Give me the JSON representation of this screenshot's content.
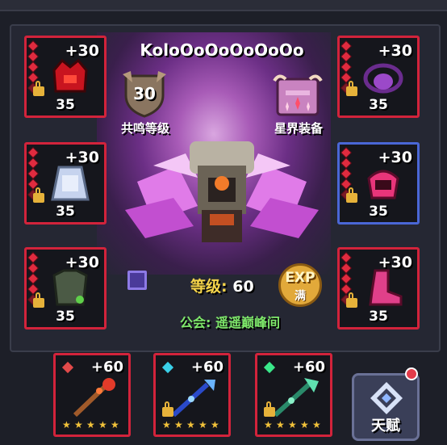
{
  "player": {
    "name": "KoloOoOoOoOoOo"
  },
  "resonance": {
    "value": "30",
    "label": "共鸣等级"
  },
  "astral": {
    "label": "星界装备"
  },
  "level": {
    "label": "等级:",
    "value": "60"
  },
  "exp_badge": {
    "top": "EXP",
    "bottom": "满"
  },
  "guild": {
    "text": "公会: 遥遥巅峰间"
  },
  "talent": {
    "label": "天赋"
  },
  "armor_slots": [
    {
      "plus": "+30",
      "level": "35",
      "item": "helmet-icon"
    },
    {
      "plus": "+30",
      "level": "35",
      "item": "cape-icon"
    },
    {
      "plus": "+30",
      "level": "35",
      "item": "chest-armor-icon"
    },
    {
      "plus": "+30",
      "level": "35",
      "item": "necklace-icon"
    },
    {
      "plus": "+30",
      "level": "35",
      "item": "gauntlet-icon"
    },
    {
      "plus": "+30",
      "level": "35",
      "item": "boots-icon"
    }
  ],
  "weapon_slots": [
    {
      "plus": "+60",
      "item": "fire-staff-icon",
      "stars": 5
    },
    {
      "plus": "+60",
      "item": "ice-trident-icon",
      "stars": 5
    },
    {
      "plus": "+60",
      "item": "green-trident-icon",
      "stars": 5
    }
  ],
  "colors": {
    "slot_border": "#d2233b",
    "selected_border": "#4a67d6",
    "guild_text": "#7ee86a",
    "level_label": "#f5d44a"
  }
}
